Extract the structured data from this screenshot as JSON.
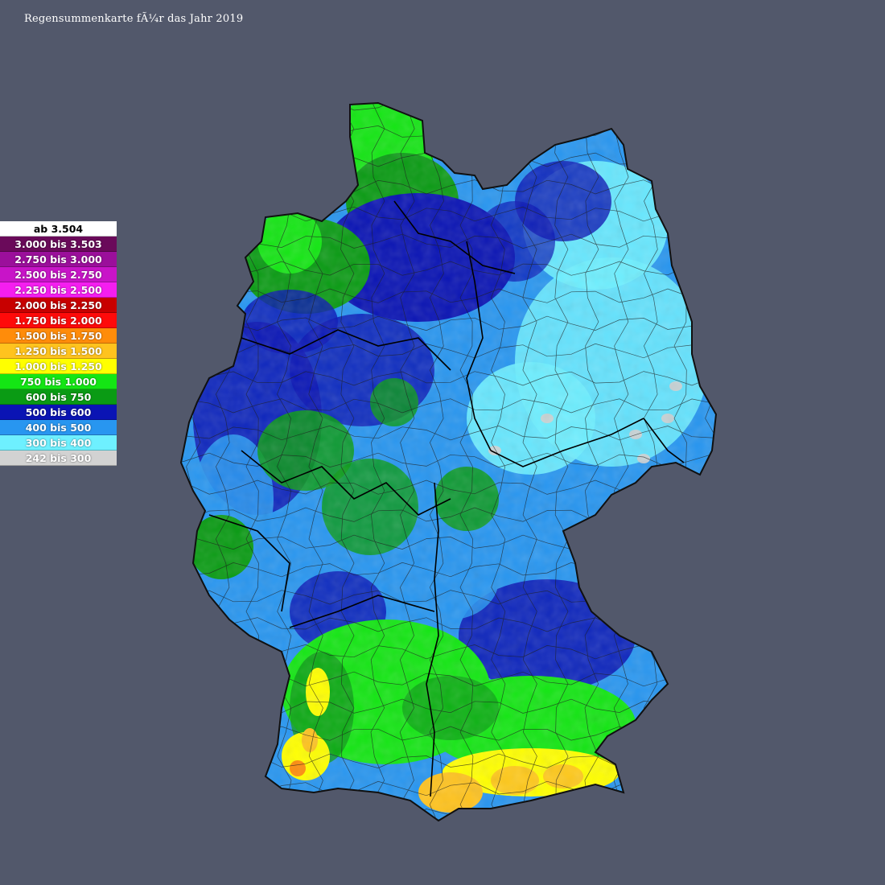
{
  "title": "Regensummenkarte fÃ¼r das Jahr 2019",
  "legend": [
    {
      "label": "ab 3.504",
      "color": "#ffffff",
      "text_color": "#000000"
    },
    {
      "label": "3.000 bis 3.503",
      "color": "#6a0a5a",
      "text_color": "#ffffff"
    },
    {
      "label": "2.750 bis 3.000",
      "color": "#9b0f9b",
      "text_color": "#ffffff"
    },
    {
      "label": "2.500 bis 2.750",
      "color": "#c814c8",
      "text_color": "#ffffff"
    },
    {
      "label": "2.250 bis 2.500",
      "color": "#f51ef0",
      "text_color": "#ffffff"
    },
    {
      "label": "2.000 bis 2.250",
      "color": "#c80000",
      "text_color": "#ffffff"
    },
    {
      "label": "1.750 bis 2.000",
      "color": "#ff0a0a",
      "text_color": "#ffffff"
    },
    {
      "label": "1.500 bis 1.750",
      "color": "#ff8c0a",
      "text_color": "#ffffff"
    },
    {
      "label": "1.250 bis 1.500",
      "color": "#ffc31e",
      "text_color": "#ffffff"
    },
    {
      "label": "1.000 bis 1.250",
      "color": "#ffff00",
      "text_color": "#ffffff"
    },
    {
      "label": "750 bis 1.000",
      "color": "#14e614",
      "text_color": "#ffffff"
    },
    {
      "label": "600 bis 750",
      "color": "#0a9b14",
      "text_color": "#ffffff"
    },
    {
      "label": "500 bis 600",
      "color": "#0a14b4",
      "text_color": "#ffffff"
    },
    {
      "label": "400 bis 500",
      "color": "#2896f0",
      "text_color": "#ffffff"
    },
    {
      "label": "300 bis 400",
      "color": "#6ef0ff",
      "text_color": "#ffffff"
    },
    {
      "label": "242 bis 300",
      "color": "#d2d2d2",
      "text_color": "#ffffff"
    }
  ],
  "colors": {
    "background": "#52586b",
    "border": "#101010"
  }
}
